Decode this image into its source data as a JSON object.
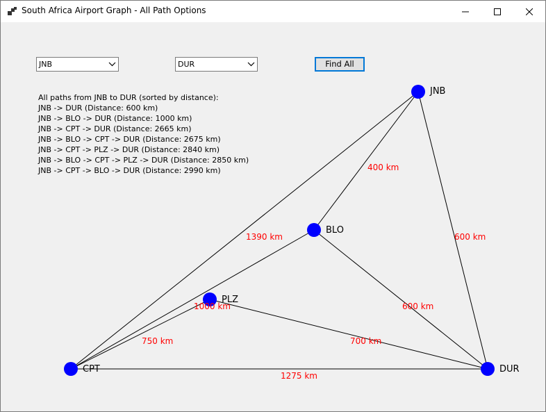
{
  "window": {
    "title": "South Africa Airport Graph - All Path Options",
    "controls": [
      "minimize-icon",
      "maximize-icon",
      "close-icon"
    ]
  },
  "form": {
    "from_value": "JNB",
    "to_value": "DUR",
    "find_button": "Find All"
  },
  "results": {
    "header": "All paths from JNB to DUR (sorted by distance):",
    "paths": [
      "JNB -> DUR (Distance: 600 km)",
      "JNB -> BLO -> DUR (Distance: 1000 km)",
      "JNB -> CPT -> DUR (Distance: 2665 km)",
      "JNB -> BLO -> CPT -> DUR (Distance: 2675 km)",
      "JNB -> CPT -> PLZ -> DUR (Distance: 2840 km)",
      "JNB -> BLO -> CPT -> PLZ -> DUR (Distance: 2850 km)",
      "JNB -> CPT -> BLO -> DUR (Distance: 2990 km)"
    ]
  },
  "graph": {
    "nodes": {
      "jnb": "JNB",
      "blo": "BLO",
      "plz": "PLZ",
      "cpt": "CPT",
      "dur": "DUR"
    },
    "edge_labels": {
      "jnb_blo": "400 km",
      "jnb_cpt": "1390 km",
      "jnb_dur": "600 km",
      "blo_dur": "600 km",
      "blo_cpt": "1000 km",
      "plz_cpt": "750 km",
      "plz_dur": "700 km",
      "cpt_dur": "1275 km"
    },
    "node_color": "#0000ff",
    "edge_color": "#000000",
    "label_color": "#ff0000"
  }
}
